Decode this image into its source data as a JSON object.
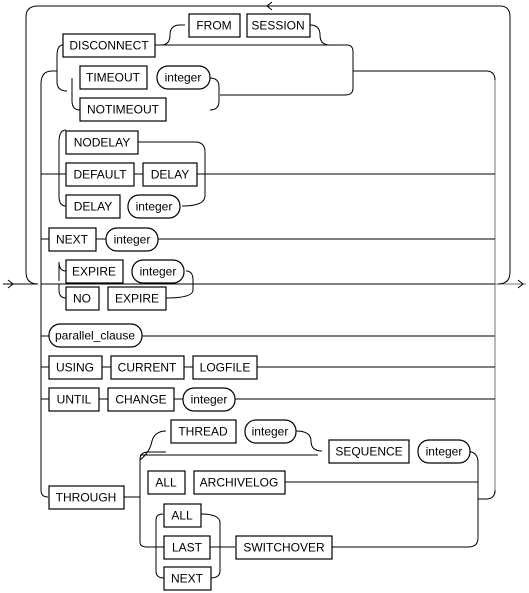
{
  "diagram": {
    "type": "railroad-syntax",
    "keywords": {
      "disconnect": "DISCONNECT",
      "from": "FROM",
      "session": "SESSION",
      "timeout": "TIMEOUT",
      "notimeout": "NOTIMEOUT",
      "nodelay": "NODELAY",
      "default": "DEFAULT",
      "delay1": "DELAY",
      "delay2": "DELAY",
      "next": "NEXT",
      "expire1": "EXPIRE",
      "no": "NO",
      "expire2": "EXPIRE",
      "using": "USING",
      "current": "CURRENT",
      "logfile": "LOGFILE",
      "until": "UNTIL",
      "change": "CHANGE",
      "through": "THROUGH",
      "thread": "THREAD",
      "sequence": "SEQUENCE",
      "all1": "ALL",
      "archivelog": "ARCHIVELOG",
      "all2": "ALL",
      "last": "LAST",
      "next2": "NEXT",
      "switchover": "SWITCHOVER"
    },
    "nonterminals": {
      "int_timeout": "integer",
      "int_delay": "integer",
      "int_next": "integer",
      "int_expire": "integer",
      "parallel": "parallel_clause",
      "int_change": "integer",
      "int_thread": "integer",
      "int_sequence": "integer"
    }
  }
}
